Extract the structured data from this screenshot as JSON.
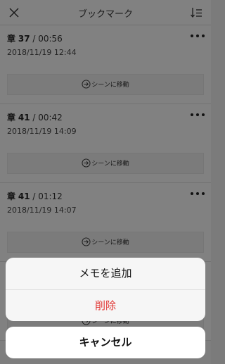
{
  "header": {
    "title": "ブックマーク",
    "close_icon": "close-icon",
    "sort_icon": "sort-icon"
  },
  "bookmarks": [
    {
      "chapter_label": "章",
      "chapter_number": "37",
      "time": " / 00:56",
      "date": "2018/11/19 12:44",
      "action_label": "シーンに移動"
    },
    {
      "chapter_label": "章",
      "chapter_number": "41",
      "time": " / 00:42",
      "date": "2018/11/19 14:09",
      "action_label": "シーンに移動"
    },
    {
      "chapter_label": "章",
      "chapter_number": "41",
      "time": " / 01:12",
      "date": "2018/11/19 14:07",
      "action_label": "シーンに移動"
    },
    {
      "chapter_label": "",
      "chapter_number": "",
      "time": "",
      "date": "",
      "action_label": "シーンに移動"
    }
  ],
  "action_sheet": {
    "add_memo_label": "メモを追加",
    "delete_label": "削除",
    "delete_color": "#e0322f"
  },
  "cancel_label": "キャンセル"
}
